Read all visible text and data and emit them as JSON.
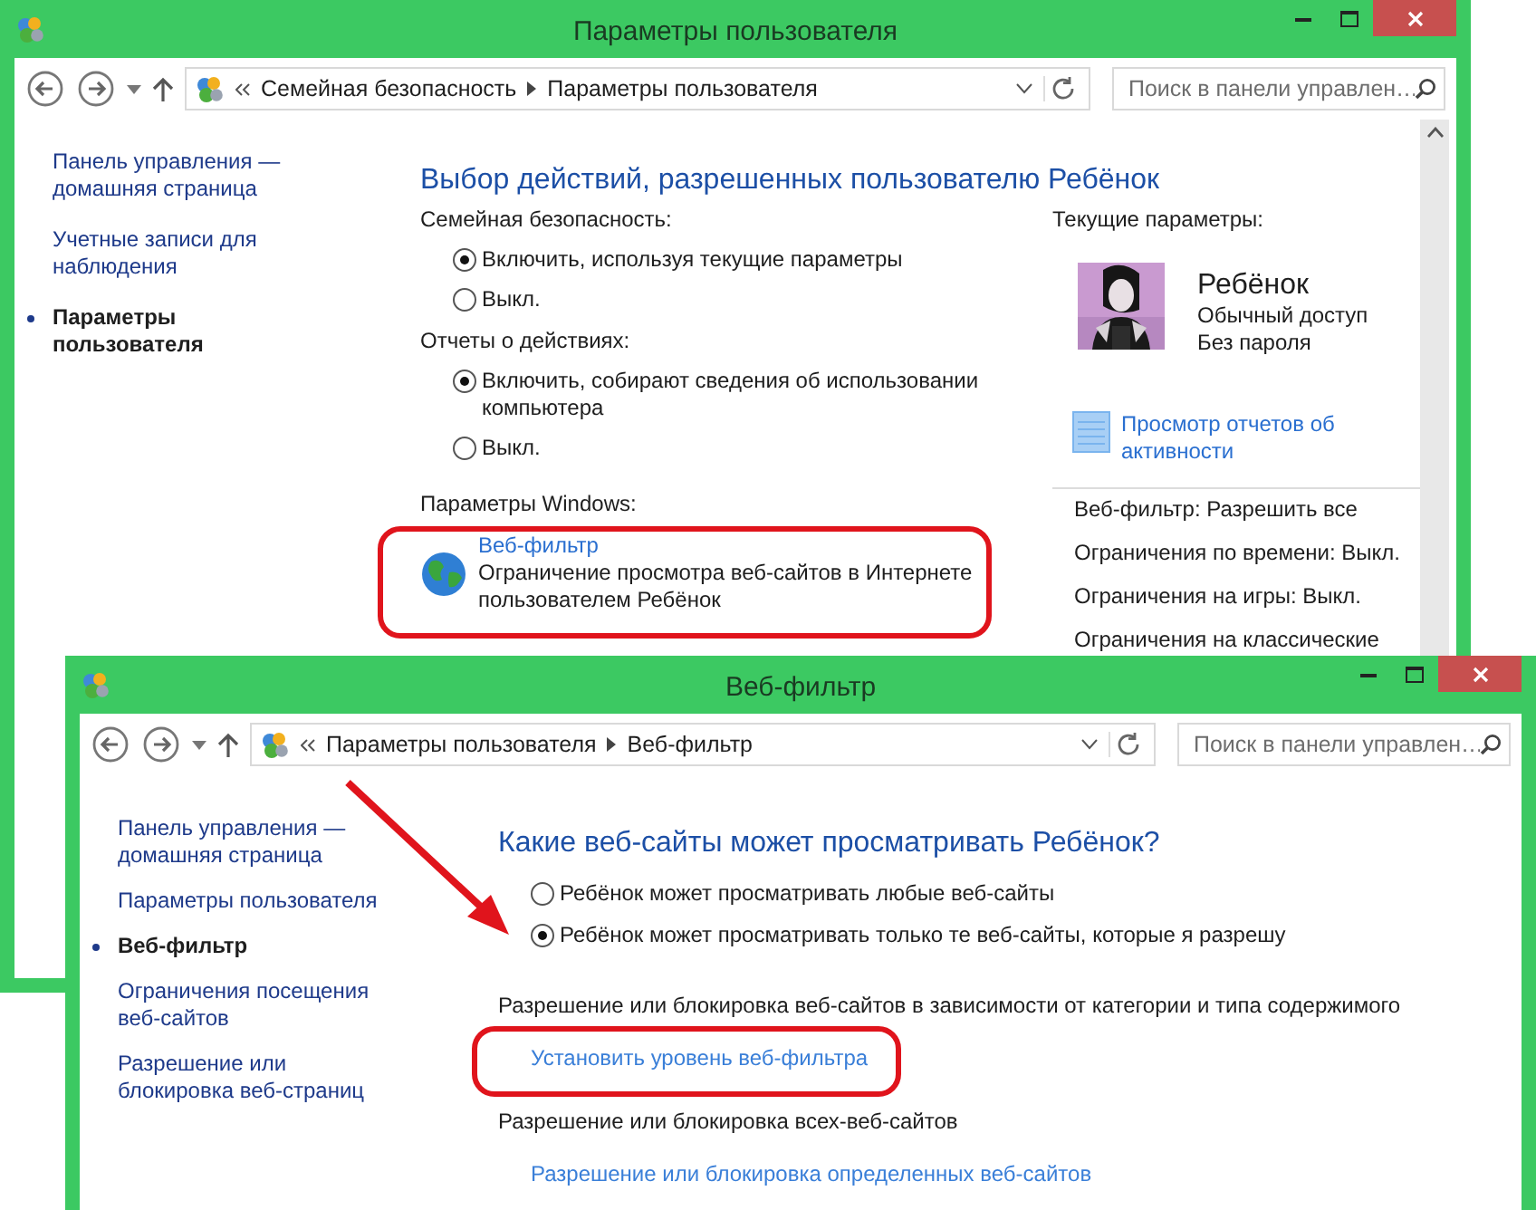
{
  "back_window": {
    "title": "Параметры пользователя",
    "breadcrumb": [
      "Семейная безопасность",
      "Параметры пользователя"
    ],
    "search_placeholder": "Поиск в панели управлен…",
    "sidebar": [
      {
        "label": "Панель управления — домашняя страница",
        "selected": false
      },
      {
        "label": "Учетные записи для наблюдения",
        "selected": false
      },
      {
        "label": "Параметры пользователя",
        "selected": true
      }
    ],
    "heading": "Выбор действий, разрешенных пользователю Ребёнок",
    "groups": [
      {
        "label": "Семейная безопасность:",
        "options": [
          {
            "label": "Включить, используя текущие параметры",
            "selected": true
          },
          {
            "label": "Выкл.",
            "selected": false
          }
        ]
      },
      {
        "label": "Отчеты о действиях:",
        "options": [
          {
            "label": "Включить, собирают сведения об использовании компьютера",
            "selected": true
          },
          {
            "label": "Выкл.",
            "selected": false
          }
        ]
      }
    ],
    "windows_settings": {
      "label": "Параметры Windows:",
      "items": [
        {
          "title": "Веб-фильтр",
          "description": "Ограничение просмотра веб-сайтов в Интернете пользователем Ребёнок"
        }
      ]
    },
    "current": {
      "label": "Текущие параметры:",
      "user": {
        "name": "Ребёнок",
        "lines": [
          "Обычный доступ",
          "Без пароля"
        ]
      },
      "report_link": "Просмотр отчетов об активности",
      "settings": [
        "Веб-фильтр: Разрешить все",
        "Ограничения по времени: Выкл.",
        "Ограничения на игры: Выкл.",
        "Ограничения на классические"
      ]
    }
  },
  "front_window": {
    "title": "Веб-фильтр",
    "breadcrumb": [
      "Параметры пользователя",
      "Веб-фильтр"
    ],
    "search_placeholder": "Поиск в панели управлен…",
    "sidebar": [
      {
        "label": "Панель управления — домашняя страница",
        "selected": false
      },
      {
        "label": "Параметры пользователя",
        "selected": false
      },
      {
        "label": "Веб-фильтр",
        "selected": true
      },
      {
        "label": "Ограничения посещения веб-сайтов",
        "selected": false
      },
      {
        "label": "Разрешение или блокировка веб-страниц",
        "selected": false
      }
    ],
    "heading": "Какие веб-сайты может просматривать Ребёнок?",
    "options": [
      {
        "label": "Ребёнок может просматривать любые веб-сайты",
        "selected": false
      },
      {
        "label": "Ребёнок может просматривать только те веб-сайты, которые я разрешу",
        "selected": true
      }
    ],
    "sections": [
      {
        "label": "Разрешение или блокировка веб-сайтов в зависимости от категории и типа содержимого",
        "link": "Установить уровень веб-фильтра"
      },
      {
        "label": "Разрешение или блокировка всех-веб-сайтов",
        "link": "Разрешение или блокировка определенных веб-сайтов"
      }
    ]
  }
}
